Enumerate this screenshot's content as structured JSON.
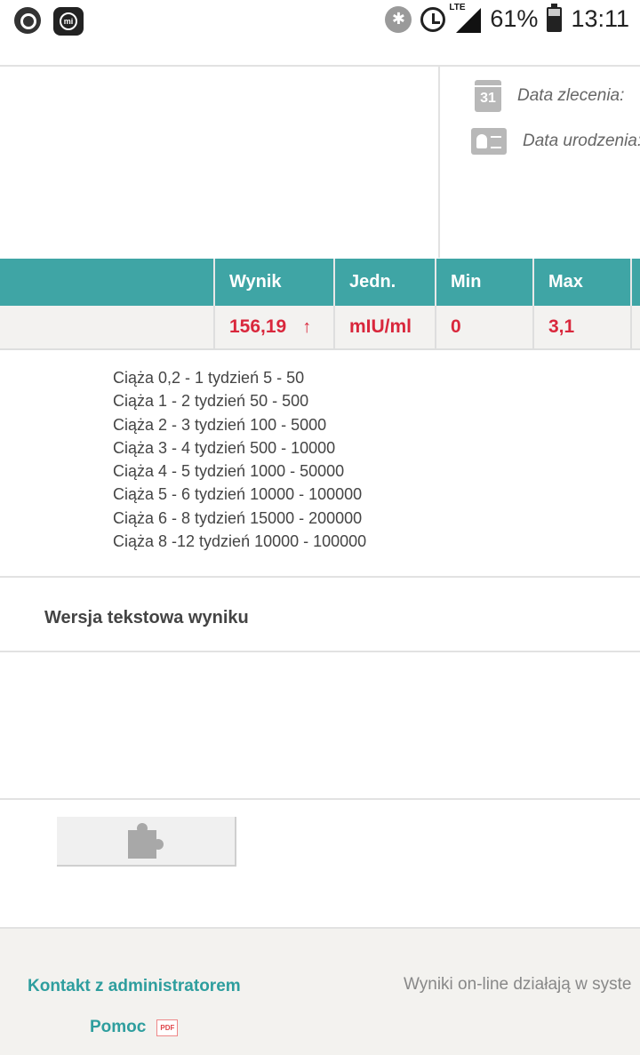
{
  "status_bar": {
    "network": "LTE",
    "battery": "61%",
    "time": "13:11"
  },
  "patient_info": {
    "order_date_label": "Data zlecenia:",
    "calendar_day": "31",
    "birth_date_label": "Data urodzenia:"
  },
  "results_table": {
    "columns": {
      "result": "Wynik",
      "unit": "Jedn.",
      "min": "Min",
      "max": "Max"
    },
    "row": {
      "result": "156,19",
      "flag": "↑",
      "unit": "mIU/ml",
      "min": "0",
      "max": "3,1"
    }
  },
  "norms": [
    "Ciąża 0,2 - 1 tydzień 5 - 50",
    "Ciąża 1 - 2 tydzień 50 - 500",
    "Ciąża 2 - 3 tydzień 100 - 5000",
    "Ciąża 3 - 4 tydzień 500 - 10000",
    "Ciąża 4 - 5 tydzień 1000 - 50000",
    "Ciąża 5 - 6 tydzień 10000 - 100000",
    "Ciąża 6 - 8 tydzień 15000 - 200000",
    "Ciąża 8 -12 tydzień 10000 - 100000"
  ],
  "text_version": {
    "title": "Wersja tekstowa wyniku"
  },
  "footer": {
    "contact_link": "Kontakt z administratorem",
    "help_link": "Pomoc",
    "pdf_badge": "PDF",
    "note": "Wyniki on-line działają w syste"
  },
  "colors": {
    "header_teal": "#3fa5a5",
    "abnormal_red": "#d9273c",
    "link_teal": "#2e9e9e"
  }
}
